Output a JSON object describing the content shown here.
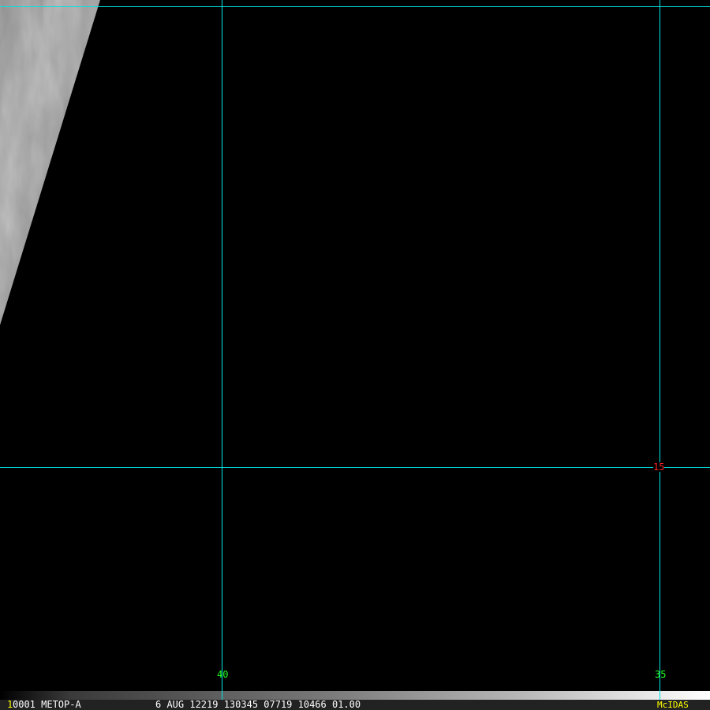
{
  "image": {
    "grid_color": "#00e5e5",
    "lon_label_color": "#22ff22",
    "lat_label_color": "#ff2222",
    "grid_labels": {
      "lon_40": "40",
      "lon_35": "35",
      "lat_15": "15"
    }
  },
  "infobar": {
    "frame_number": "1",
    "satellite": "0001 METOP-A",
    "datetime_info": "6 AUG 12219 130345 07719 10466 01.00",
    "brand": "McIDAS"
  }
}
